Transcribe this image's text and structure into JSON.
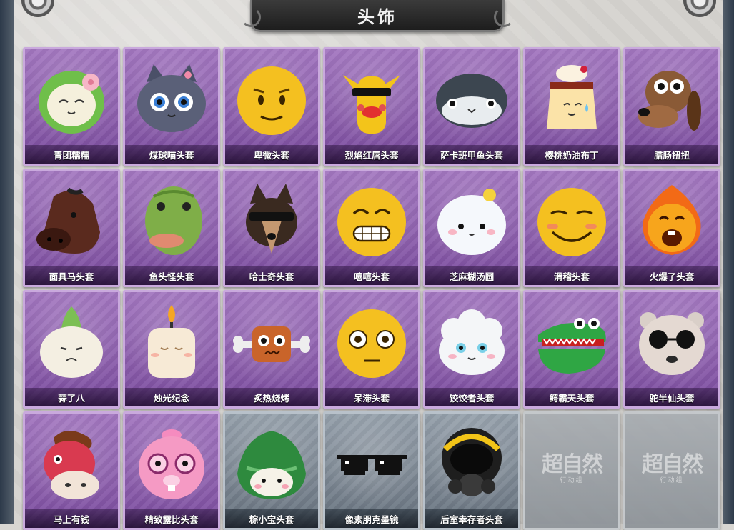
{
  "title": "头饰",
  "items": [
    {
      "label": "青团糯糯",
      "icon": "green-rice-ball-icon"
    },
    {
      "label": "煤球喵头套",
      "icon": "black-cat-icon"
    },
    {
      "label": "卑微头套",
      "icon": "humble-face-icon"
    },
    {
      "label": "烈焰红唇头套",
      "icon": "red-lips-pikachu-icon"
    },
    {
      "label": "萨卡班甲鱼头套",
      "icon": "sacabambaspis-icon"
    },
    {
      "label": "樱桃奶油布丁",
      "icon": "cherry-pudding-icon"
    },
    {
      "label": "腊肠扭扭",
      "icon": "dachshund-icon"
    },
    {
      "label": "面具马头套",
      "icon": "horse-mask-icon"
    },
    {
      "label": "鱼头怪头套",
      "icon": "fish-head-icon"
    },
    {
      "label": "哈士奇头套",
      "icon": "husky-icon"
    },
    {
      "label": "嘻嘻头套",
      "icon": "grin-face-icon"
    },
    {
      "label": "芝麻糊汤圆",
      "icon": "tangyuan-icon"
    },
    {
      "label": "滑稽头套",
      "icon": "smirk-face-icon"
    },
    {
      "label": "火爆了头套",
      "icon": "fire-face-icon"
    },
    {
      "label": "蒜了八",
      "icon": "garlic-icon"
    },
    {
      "label": "烛光纪念",
      "icon": "candle-icon"
    },
    {
      "label": "炙热烧烤",
      "icon": "grilled-meat-icon"
    },
    {
      "label": "呆滞头套",
      "icon": "dazed-face-icon"
    },
    {
      "label": "饺饺者头套",
      "icon": "dumpling-icon"
    },
    {
      "label": "鳄霸天头套",
      "icon": "crocodile-icon"
    },
    {
      "label": "驼半仙头套",
      "icon": "alpaca-sunglasses-icon"
    },
    {
      "label": "马上有钱",
      "icon": "red-horse-icon"
    },
    {
      "label": "精致露比头套",
      "icon": "pink-beaver-icon"
    },
    {
      "label": "粽小宝头套",
      "icon": "zongzi-icon"
    },
    {
      "label": "像素朋克墨镜",
      "icon": "pixel-sunglasses-icon"
    },
    {
      "label": "后室幸存者头套",
      "icon": "gas-mask-helmet-icon"
    },
    {
      "label": "",
      "icon": "empty-slot"
    },
    {
      "label": "",
      "icon": "empty-slot"
    }
  ],
  "empty_slot": {
    "logo": "超自然",
    "sub": "行动组"
  }
}
